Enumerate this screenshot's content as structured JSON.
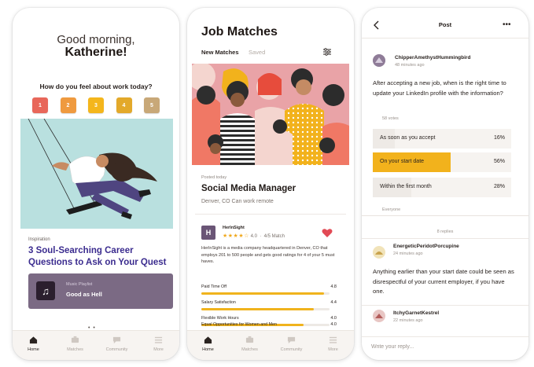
{
  "home": {
    "greeting": "Good morning,",
    "name": "Katherine!",
    "mood_question": "How do you feel about work today?",
    "moods": [
      {
        "label": "1",
        "color": "#e8675a"
      },
      {
        "label": "2",
        "color": "#ef9a3f"
      },
      {
        "label": "3",
        "color": "#f4b61c"
      },
      {
        "label": "4",
        "color": "#e3a92a"
      },
      {
        "label": "5",
        "color": "#c8a878"
      }
    ],
    "article_tag": "Inspiration",
    "article_title": "3 Soul-Searching Career Questions to Ask on Your Quest",
    "music_tag": "Music Playlist",
    "music_title": "Good as Hell",
    "more_dots": "• •"
  },
  "nav": [
    {
      "label": "Home",
      "icon": "home-icon"
    },
    {
      "label": "Matches",
      "icon": "matches-icon"
    },
    {
      "label": "Community",
      "icon": "community-icon"
    },
    {
      "label": "More",
      "icon": "more-menu-icon"
    }
  ],
  "jobs": {
    "title": "Job Matches",
    "tab_new": "New Matches",
    "tab_saved": "Saved",
    "posted": "Posted today",
    "job_title": "Social Media Manager",
    "location": "Denver, CO   Can work remote",
    "company_logo": "H",
    "company_name": "HerInSight",
    "stars": "★★★★☆",
    "rating": "4.0",
    "match": "4/5 Match",
    "description": "HerInSight is a media company headquartered in Denver, CO that employs 201 to 500 people and gets good ratings for 4 of your 5 must haves.",
    "metrics": [
      {
        "label": "Paid Time Off",
        "value": "4.8",
        "fraction": 0.96
      },
      {
        "label": "Salary Satisfaction",
        "value": "4.4",
        "fraction": 0.88
      },
      {
        "label": "Flexible Work Hours",
        "value": "4.0",
        "fraction": 0.8
      },
      {
        "label": "Equal Opportunities for Women and Men",
        "value": "4.0",
        "fraction": 0.8
      }
    ]
  },
  "post": {
    "header": "Post",
    "author": "ChipperAmethystHummingbird",
    "time": "48 minutes ago",
    "question": "After accepting a new job, when is the right time to update your LinkedIn profile with the information?",
    "votes": "58 votes",
    "options": [
      {
        "label": "As soon as you accept",
        "pct": "16%",
        "fraction": 0.16,
        "selected": false
      },
      {
        "label": "On your start date",
        "pct": "56%",
        "fraction": 0.56,
        "selected": true
      },
      {
        "label": "Within the first month",
        "pct": "28%",
        "fraction": 0.28,
        "selected": false
      }
    ],
    "audience": "Everyone",
    "replies_count": "8 replies",
    "reply1": {
      "author": "EnergeticPeridotPorcupine",
      "time": "24 minutes ago",
      "text": "Anything earlier than your start date could be seen as disrespectful of your current employer, if you have one."
    },
    "reply2": {
      "author": "ItchyGarnetKestrel",
      "time": "22 minutes ago"
    },
    "reply_placeholder": "Write your reply..."
  },
  "colors": {
    "accent_yellow": "#f2b21c",
    "article_purple": "#3b2c8f",
    "hero_teal": "#b9e0df",
    "hero_pink": "#e9a3a7",
    "music_card": "#7b6a84"
  }
}
